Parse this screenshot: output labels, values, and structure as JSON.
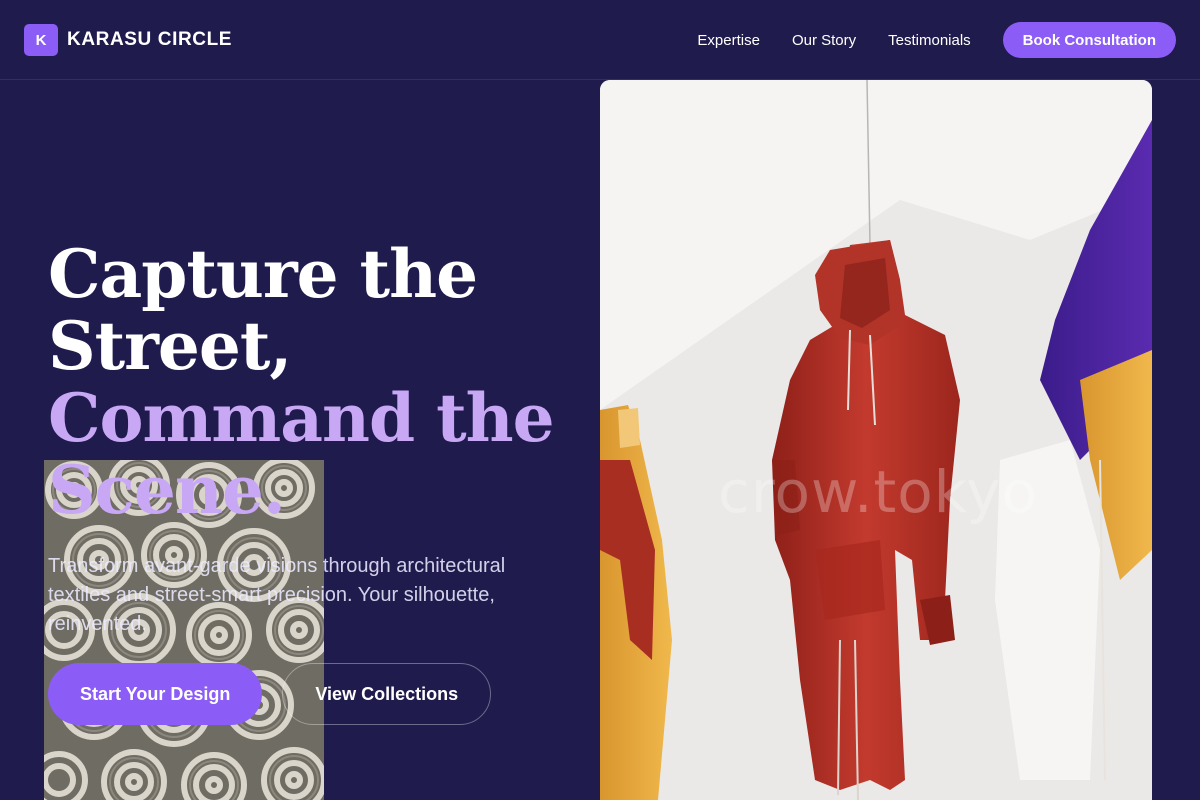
{
  "header": {
    "logo_mark": "K",
    "brand": "KARASU CIRCLE",
    "nav": [
      {
        "label": "Expertise"
      },
      {
        "label": "Our Story"
      },
      {
        "label": "Testimonials"
      }
    ],
    "cta_label": "Book Consultation"
  },
  "hero": {
    "headline_line1": "Capture the",
    "headline_line2": "Street,",
    "headline_line3": "Command the",
    "headline_line4": "Scene.",
    "lead": "Transform avant-garde visions through architectural textiles and street-smart precision. Your silhouette, reinvented.",
    "primary_cta": "Start Your Design",
    "secondary_cta": "View Collections"
  },
  "media": {
    "watermark": "crow.tokyo"
  },
  "colors": {
    "background": "#1f1b4d",
    "accent": "#8b5cf6",
    "headline_accent": "#c8a8f5"
  }
}
